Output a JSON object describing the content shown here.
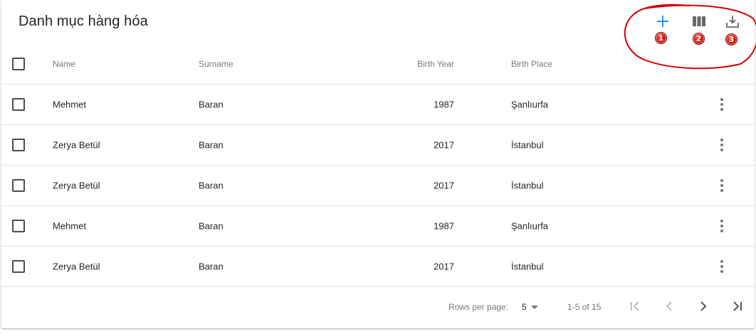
{
  "toolbar": {
    "title": "Danh mục hàng hóa",
    "actions": [
      {
        "name": "add",
        "icon": "plus-icon",
        "badge": "1"
      },
      {
        "name": "columns",
        "icon": "view-column-icon",
        "badge": "2"
      },
      {
        "name": "export",
        "icon": "download-icon",
        "badge": "3"
      }
    ]
  },
  "table": {
    "columns": [
      "Name",
      "Surname",
      "Birth Year",
      "Birth Place"
    ],
    "rows": [
      {
        "name": "Mehmet",
        "surname": "Baran",
        "birth_year": "1987",
        "birth_place": "Şanlıurfa"
      },
      {
        "name": "Zerya Betül",
        "surname": "Baran",
        "birth_year": "2017",
        "birth_place": "İstanbul"
      },
      {
        "name": "Zerya Betül",
        "surname": "Baran",
        "birth_year": "2017",
        "birth_place": "İstanbul"
      },
      {
        "name": "Mehmet",
        "surname": "Baran",
        "birth_year": "1987",
        "birth_place": "Şanlıurfa"
      },
      {
        "name": "Zerya Betül",
        "surname": "Baran",
        "birth_year": "2017",
        "birth_place": "İstanbul"
      }
    ]
  },
  "pagination": {
    "rows_per_page_label": "Rows per page:",
    "rows_per_page_value": "5",
    "range_text": "1-5 of 15"
  },
  "colors": {
    "accent": "#2196f3",
    "annotation": "#d40000"
  }
}
